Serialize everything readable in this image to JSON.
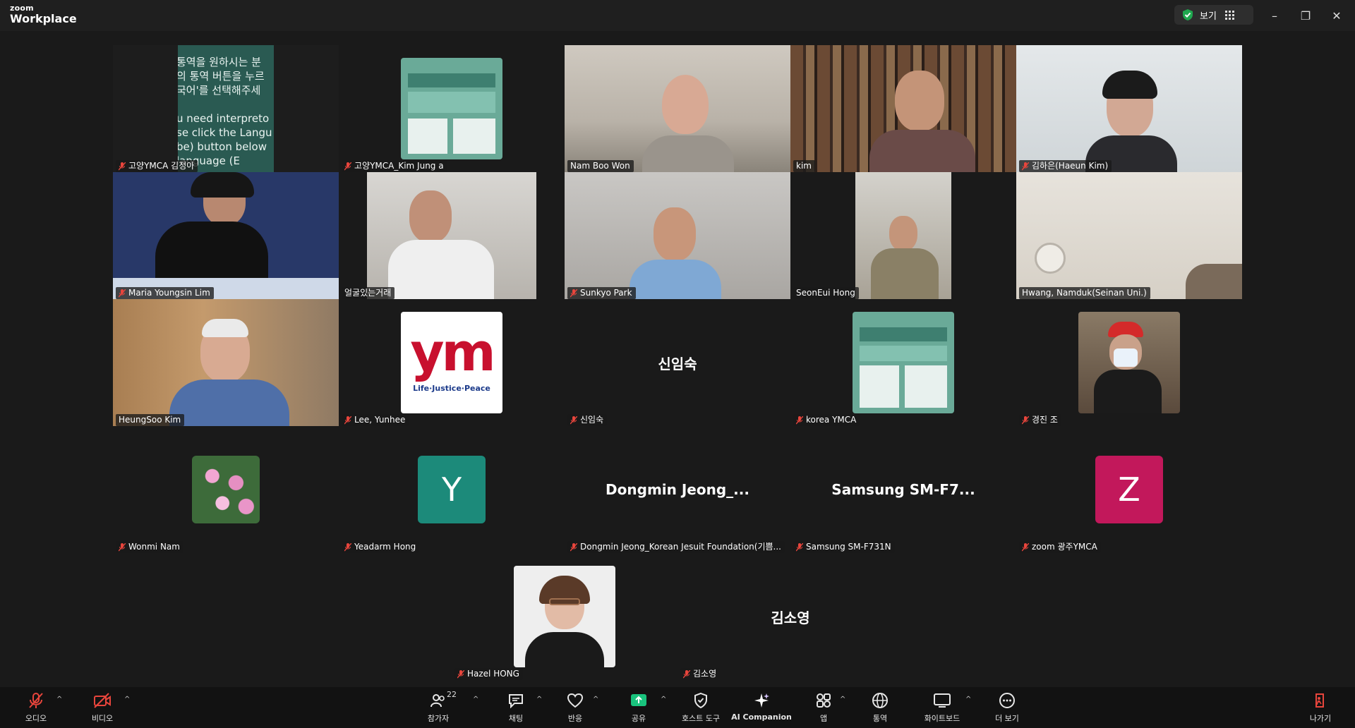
{
  "app": {
    "logo_line1": "zoom",
    "logo_line2": "Workplace"
  },
  "titlebar": {
    "view_label": "보기",
    "minimize": "–",
    "restore": "❐",
    "close": "✕"
  },
  "colors": {
    "bg": "#1a1a1a",
    "active_border": "#3ad07a",
    "green_share": "#19c37d",
    "avatar_y": "#1c8a7a",
    "avatar_z": "#c2185b",
    "mic_off": "#e8453c"
  },
  "tiles": {
    "t1": {
      "name": "고양YMCA 김정아",
      "slide_lines": [
        "통역을 원하시는 분",
        "의 통역 버튼을 누르",
        "국어'를 선택해주세",
        "",
        "u need interpreto",
        "se click the Langu",
        "be) button below",
        "language (E"
      ]
    },
    "t2": {
      "name": "고양YMCA_Kim Jung a"
    },
    "t3": {
      "name": "Nam Boo Won"
    },
    "t4": {
      "name": "kim"
    },
    "t5": {
      "name": "김하은(Haeun Kim)"
    },
    "t6": {
      "name": "Maria Youngsin Lim"
    },
    "t7": {
      "name": "얼굴있는거래"
    },
    "t8": {
      "name": "Sunkyo Park"
    },
    "t9": {
      "name": "SeonEui Hong"
    },
    "t10": {
      "name": "Hwang, Namduk(Seinan Uni.)"
    },
    "t11": {
      "name": "HeungSoo Kim"
    },
    "t12": {
      "name": "Lee, Yunhee",
      "logo_text": "ym",
      "logo_tagline": "Life·Justice·Peace"
    },
    "t13": {
      "name": "신임숙",
      "big": "신임숙"
    },
    "t14": {
      "name": "korea YMCA"
    },
    "t15": {
      "name": "경진 조"
    },
    "t16": {
      "name": "Wonmi Nam"
    },
    "t17": {
      "name": "Yeadarm Hong",
      "letter": "Y"
    },
    "t18": {
      "name": "Dongmin Jeong_Korean Jesuit Foundation(기쁨...",
      "big": "Dongmin  Jeong_..."
    },
    "t19": {
      "name": "Samsung SM-F731N",
      "big": "Samsung  SM-F7..."
    },
    "t20": {
      "name": "zoom 광주YMCA",
      "letter": "Z"
    },
    "t21": {
      "name": "Hazel HONG"
    },
    "t22": {
      "name": "김소영",
      "big": "김소영"
    }
  },
  "toolbar": {
    "audio": "오디오",
    "video": "비디오",
    "participants": "참가자",
    "participants_count": "22",
    "chat": "채팅",
    "react": "반응",
    "share": "공유",
    "host_tools": "호스트 도구",
    "ai_companion": "AI Companion",
    "apps": "앱",
    "interpret": "통역",
    "whiteboard": "화이트보드",
    "more": "더 보기",
    "leave": "나가기"
  }
}
